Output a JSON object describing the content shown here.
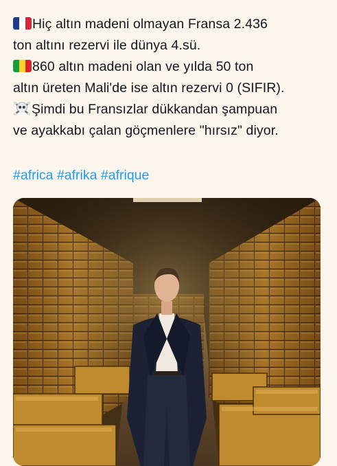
{
  "tweet": {
    "lines": [
      "Hiç altın madeni olmayan Fransa 2.436",
      "ton altını rezervi ile dünya 4.sü.",
      "860 altın madeni olan ve yılda 50 ton",
      "altın üreten Mali'de ise altın rezervi 0 (SIFIR).",
      "Şimdi bu Fransızlar dükkandan şampuan",
      "ve ayakkabı çalan göçmenlere \"hırsız\" diyor."
    ],
    "emoji": {
      "france_flag": "france-flag",
      "mali_flag": "mali-flag",
      "skull": "skull-crossbones"
    },
    "hashtags": [
      "#africa",
      "#afrika",
      "#afrique"
    ]
  },
  "colors": {
    "background": "#fcf5ec",
    "link": "#1d9bf0",
    "text": "#14171a",
    "gold": "#b8862c"
  }
}
